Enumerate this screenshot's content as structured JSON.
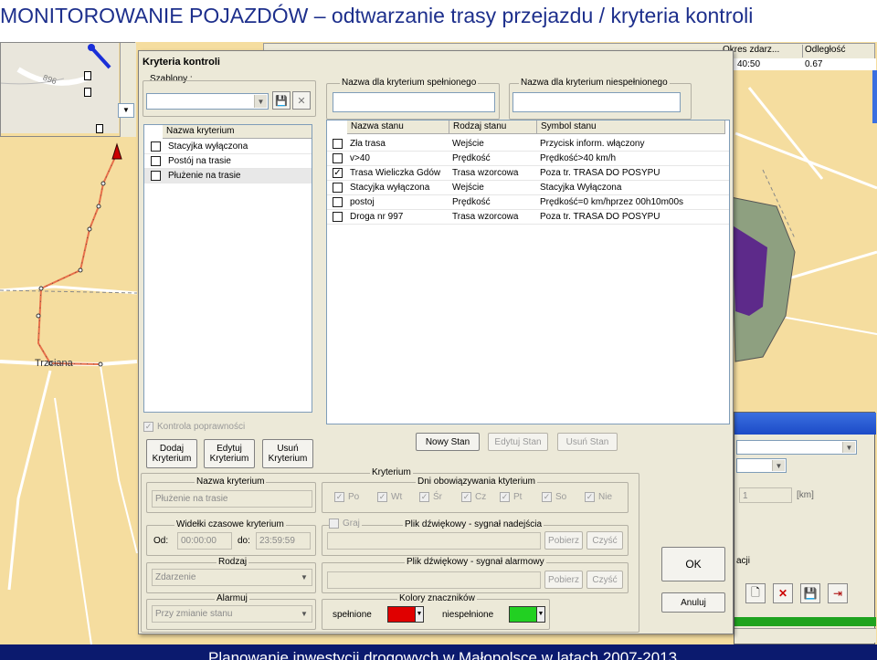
{
  "slide": {
    "title": "MONITOROWANIE POJAZDÓW – odtwarzanie trasy przejazdu / kryteria kontroli",
    "footer": "Planowanie inwestycji drogowych w Małopolsce w latach 2007-2013"
  },
  "map": {
    "road_label_896": "896",
    "place_label": "Trzciana"
  },
  "background_app": {
    "grid_headers": [
      "Okres zdarz...",
      "Odległość"
    ],
    "grid_row": [
      "40:50",
      "0.67"
    ],
    "distance_value": "1",
    "distance_unit": "[km]",
    "partial_label": "acji"
  },
  "dialog": {
    "title": "Kryteria kontroli",
    "templates": {
      "label": "Szablony :",
      "value": ""
    },
    "met_name": {
      "label": "Nazwa dla kryterium spełnionego",
      "value": ""
    },
    "unmet_name": {
      "label": "Nazwa dla kryterium niespełnionego",
      "value": ""
    },
    "criteria_list": {
      "header": "Nazwa kryterium",
      "items": [
        {
          "label": "Stacyjka wyłączona",
          "checked": false
        },
        {
          "label": "Postój na trasie",
          "checked": false
        },
        {
          "label": "Płużenie na trasie",
          "checked": false
        }
      ]
    },
    "states_table": {
      "headers": [
        "Nazwa stanu",
        "Rodzaj stanu",
        "Symbol stanu"
      ],
      "rows": [
        {
          "name": "Zła trasa",
          "type": "Wejście",
          "symbol": "Przycisk inform. włączony",
          "checked": false
        },
        {
          "name": "v>40",
          "type": "Prędkość",
          "symbol": "Prędkość>40 km/h",
          "checked": false
        },
        {
          "name": "Trasa Wieliczka Gdów",
          "type": "Trasa wzorcowa",
          "symbol": "Poza tr. TRASA DO POSYPU",
          "checked": true
        },
        {
          "name": "Stacyjka wyłączona",
          "type": "Wejście",
          "symbol": "Stacyjka Wyłączona",
          "checked": false
        },
        {
          "name": "postoj",
          "type": "Prędkość",
          "symbol": "Prędkość=0 km/hprzez  00h10m00s",
          "checked": false
        },
        {
          "name": "Droga nr 997",
          "type": "Trasa wzorcowa",
          "symbol": "Poza tr. TRASA DO POSYPU",
          "checked": false
        }
      ]
    },
    "correctness_check": {
      "label": "Kontrola poprawności",
      "checked": true
    },
    "buttons": {
      "add_criterion": "Dodaj Kryterium",
      "edit_criterion": "Edytuj Kryterium",
      "delete_criterion": "Usuń Kryterium",
      "new_state": "Nowy Stan",
      "edit_state": "Edytuj Stan",
      "delete_state": "Usuń Stan",
      "ok": "OK",
      "cancel": "Anuluj"
    },
    "criterion_group": {
      "label": "Kryterium",
      "name_label": "Nazwa kryterium",
      "name_value": "Płużenie na trasie",
      "days_label": "Dni obowiązywania ktyterium",
      "days": [
        {
          "label": "Po",
          "checked": true
        },
        {
          "label": "Wt",
          "checked": true
        },
        {
          "label": "Śr",
          "checked": true
        },
        {
          "label": "Cz",
          "checked": true
        },
        {
          "label": "Pt",
          "checked": true
        },
        {
          "label": "So",
          "checked": true
        },
        {
          "label": "Nie",
          "checked": true
        }
      ],
      "time_window_label": "Widełki czasowe kryterium",
      "from_label": "Od:",
      "from_value": "00:00:00",
      "to_label": "do:",
      "to_value": "23:59:59",
      "play_sound_label": "Graj",
      "arrival_sound_label": "Plik dźwiękowy - sygnał nadejścia",
      "alarm_sound_label": "Plik dźwiękowy - sygnał alarmowy",
      "fetch": "Pobierz",
      "clear": "Czyść",
      "kind_label": "Rodzaj",
      "kind_value": "Zdarzenie",
      "alarm_label": "Alarmuj",
      "alarm_value": "Przy zmianie stanu",
      "marker_colors_label": "Kolory znaczników",
      "met_color_label": "spełnione",
      "unmet_color_label": "niespełnione"
    }
  },
  "colors": {
    "met_color": "#e00000",
    "unmet_color": "#22d022",
    "title_text": "#1d2f8c",
    "footer_bg": "#0b1a6e",
    "map_bg": "#f5dd9f",
    "route_line": "#e8704a",
    "purple_zone": "#5d2a8a"
  },
  "icons": [
    "save-icon",
    "delete-icon",
    "dropdown-arrow-icon",
    "vehicle-marker-icon",
    "new-document-icon",
    "exit-icon"
  ]
}
